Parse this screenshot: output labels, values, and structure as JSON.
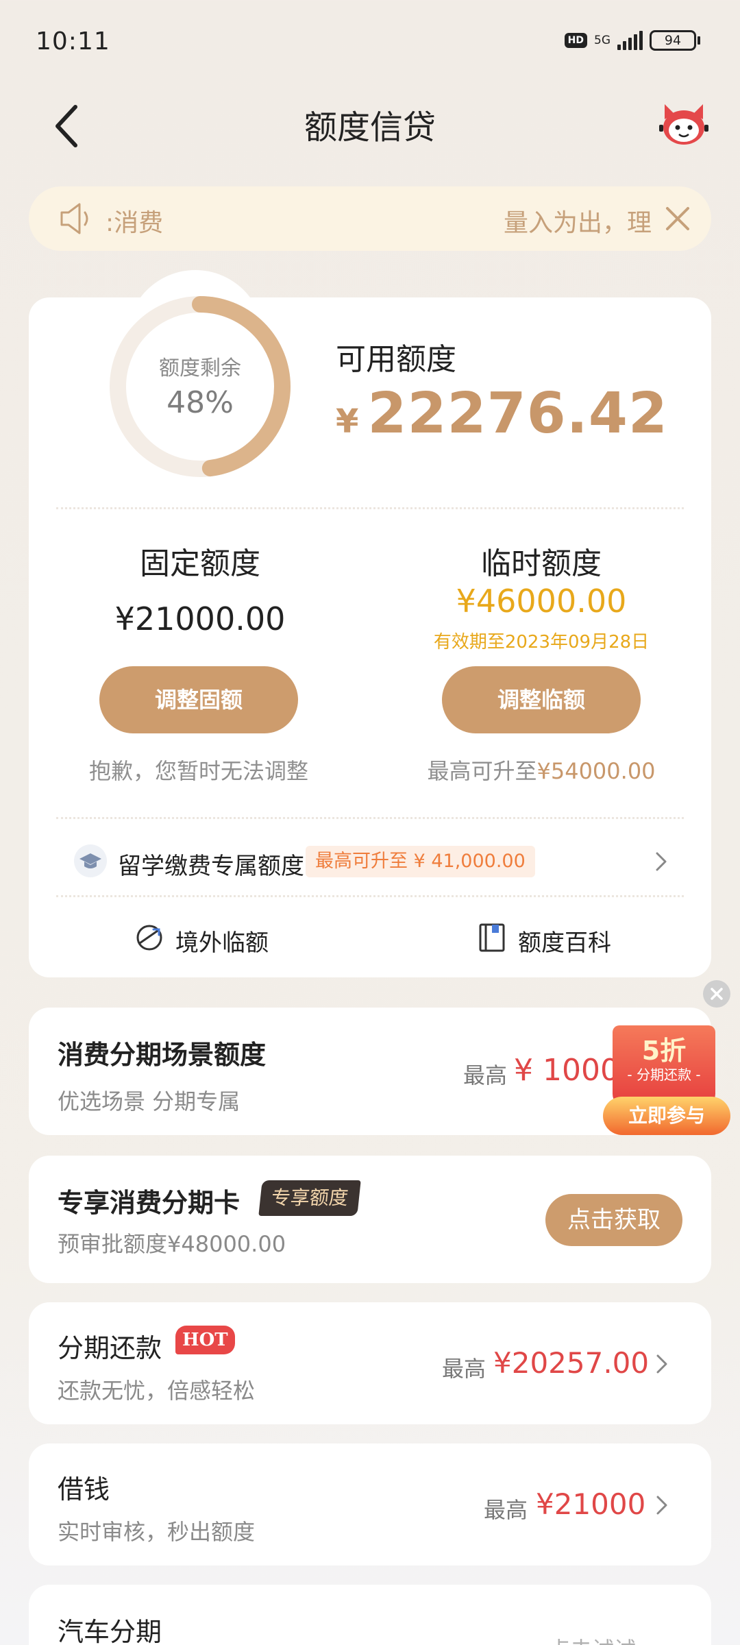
{
  "status_bar": {
    "time": "10:11",
    "hd": "HD",
    "network": "5G",
    "battery": "94"
  },
  "header": {
    "title": "额度信贷"
  },
  "notice": {
    "text_left": ":消费",
    "text_right": "量入为出，理"
  },
  "credit": {
    "ring_label": "额度剩余",
    "remaining_percent": "48%",
    "remaining_fraction": 0.48,
    "available_label": "可用额度",
    "currency": "¥",
    "available_amount": "22276.42",
    "fixed": {
      "title": "固定额度",
      "amount": "¥21000.00",
      "button": "调整固额",
      "note": "抱歉，您暂时无法调整"
    },
    "temporary": {
      "title": "临时额度",
      "amount": "¥46000.00",
      "valid_until": "有效期至2023年09月28日",
      "button": "调整临额",
      "note_prefix": "最高可升至",
      "note_amount": "¥54000.00"
    },
    "study_abroad": {
      "label": "留学缴费专属额度",
      "tag": "最高可升至 ¥ 41,000.00"
    },
    "tools": [
      {
        "label": "境外临额"
      },
      {
        "label": "额度百科"
      }
    ]
  },
  "scene_card": {
    "title": "消费分期场景额度",
    "subtitle": "优选场景 分期专属",
    "max_label": "最高",
    "amount": "¥ 10000",
    "promo": {
      "discount": "5折",
      "subtitle": "- 分期还款 -",
      "button": "立即参与"
    }
  },
  "exclusive_card": {
    "title": "专享消费分期卡",
    "tag": "专享额度",
    "subtitle": "预审批额度¥48000.00",
    "button": "点击获取"
  },
  "installment_card": {
    "title": "分期还款",
    "tag": "HOT",
    "subtitle": "还款无忧，倍感轻松",
    "max_label": "最高",
    "amount": "¥20257.00"
  },
  "borrow_card": {
    "title": "借钱",
    "subtitle": "实时审核，秒出额度",
    "max_label": "最高",
    "amount": "¥21000"
  },
  "car_card": {
    "title": "汽车分期",
    "hint": "点击试试"
  },
  "colors": {
    "accent": "#cd9c6d",
    "gold": "#c8976a",
    "yellow": "#e8a81b",
    "red": "#e04747"
  }
}
